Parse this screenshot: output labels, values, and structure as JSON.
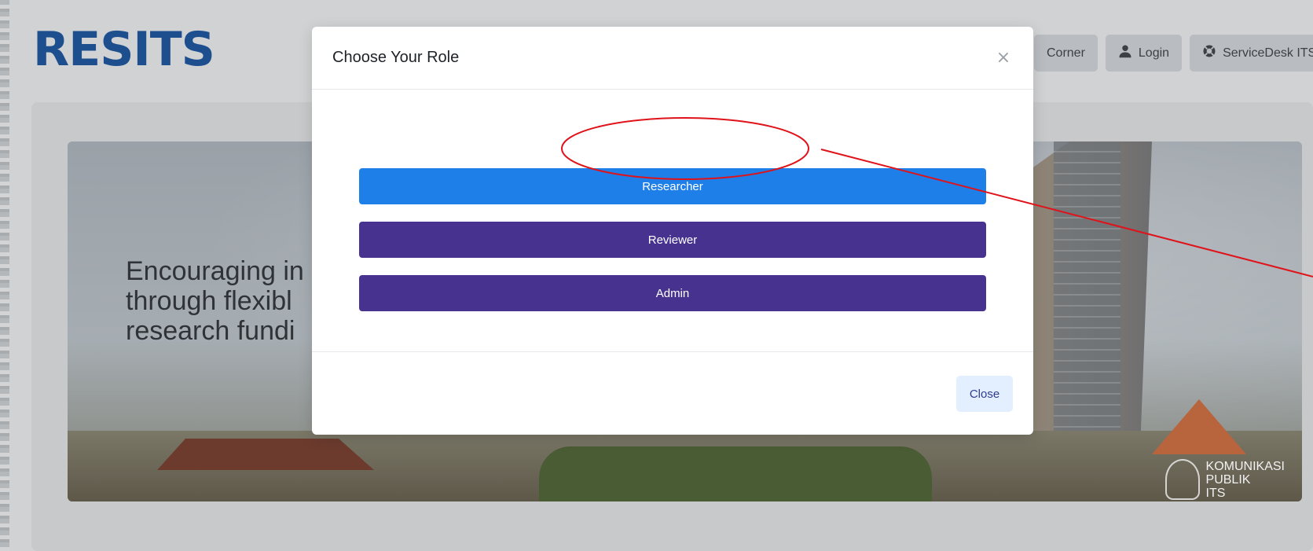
{
  "site": {
    "logo_text": "RESITS"
  },
  "topnav": {
    "corner_label": "Corner",
    "login_label": "Login",
    "servicedesk_label": "ServiceDesk ITS"
  },
  "hero": {
    "line1": "Encouraging in",
    "line2": "through flexibl",
    "line3": "research fundi",
    "watermark_line1": "KOMUNIKASI",
    "watermark_line2": "PUBLIK",
    "watermark_line3": "ITS"
  },
  "modal": {
    "title": "Choose Your Role",
    "close_symbol": "×",
    "roles": [
      {
        "label": "Researcher",
        "color": "#1e7fe8"
      },
      {
        "label": "Reviewer",
        "color": "#47338f"
      },
      {
        "label": "Admin",
        "color": "#47338f"
      }
    ],
    "close_button": "Close"
  },
  "annotation": {
    "color": "#e0121a",
    "target": "Researcher"
  }
}
